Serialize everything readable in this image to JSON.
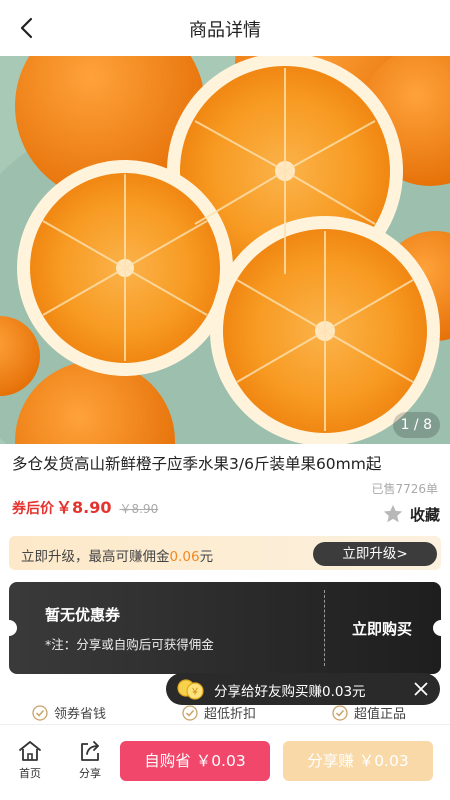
{
  "header": {
    "title": "商品详情"
  },
  "gallery": {
    "pager": "1 / 8"
  },
  "product": {
    "title": "多仓发货高山新鲜橙子应季水果3/6斤装单果60mm起",
    "sold": "已售7726单",
    "price_label": "券后价",
    "price": "￥8.90",
    "original_price": "￥8.90",
    "favorite_label": "收藏"
  },
  "upgrade": {
    "text_prefix": "立即升级，最高可赚佣金",
    "amount": "0.06",
    "unit": "元",
    "button": "立即升级>"
  },
  "coupon": {
    "title": "暂无优惠券",
    "note": "*注：分享或自购后可获得佣金",
    "buy": "立即购买"
  },
  "toast": {
    "text": "分享给好友购买赚0.03元"
  },
  "features": [
    {
      "label": "领券省钱"
    },
    {
      "label": "超低折扣"
    },
    {
      "label": "超值正品"
    }
  ],
  "bottom_bar": {
    "home": "首页",
    "share": "分享",
    "buy_button": "自购省 ￥0.03",
    "share_button": "分享赚 ￥0.03"
  },
  "colors": {
    "price_red": "#e3342f",
    "buy_pink": "#f0476a",
    "share_gold": "#f8d9a7",
    "accent_orange": "#f08a22"
  }
}
